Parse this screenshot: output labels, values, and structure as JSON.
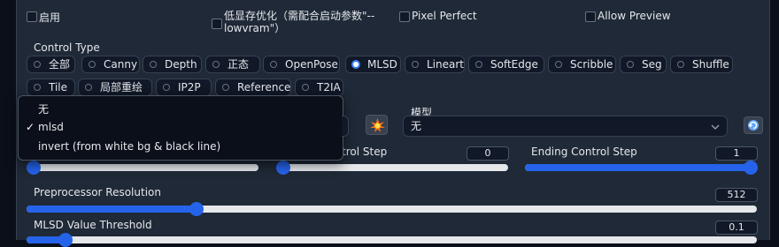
{
  "options": {
    "enable": "启用",
    "low_vram": "低显存优化（需配合启动参数\"--lowvram\"）",
    "pixel_perfect": "Pixel Perfect",
    "allow_preview": "Allow Preview"
  },
  "control_type": {
    "label": "Control Type",
    "selected": "MLSD",
    "items": [
      "全部",
      "Canny",
      "Depth",
      "正态",
      "OpenPose",
      "MLSD",
      "Lineart",
      "SoftEdge",
      "Scribble",
      "Seg",
      "Shuffle",
      "Tile",
      "局部重绘",
      "IP2P",
      "Reference",
      "T2IA"
    ]
  },
  "preprocessor_dropdown": {
    "options": [
      "无",
      "mlsd",
      "invert (from white bg & black line)"
    ],
    "selected": "mlsd"
  },
  "model": {
    "label": "模型",
    "value": "无"
  },
  "sliders": {
    "control_weight": {
      "value_fraction": 0.0
    },
    "starting_step": {
      "label_visible": "trol Step",
      "value": "0"
    },
    "ending_step": {
      "label": "Ending Control Step",
      "value": "1"
    },
    "resolution": {
      "label": "Preprocessor Resolution",
      "value": "512"
    },
    "threshold": {
      "label": "MLSD Value Threshold",
      "value": "0.1"
    }
  },
  "icons": {
    "run_preprocessor": "explosion-icon",
    "refresh": "refresh-icon",
    "chevron": "chevron-down-icon"
  },
  "colors": {
    "accent": "#2563eb",
    "panel": "#1f2937",
    "background": "#0b0f19"
  }
}
